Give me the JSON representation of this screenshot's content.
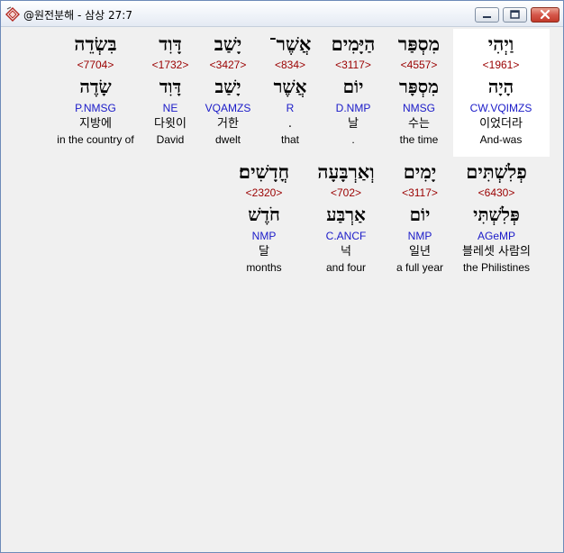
{
  "window": {
    "title": "@원전분해 - 삼상 27:7",
    "icons": {
      "app": "bible-book-icon",
      "minimize": "minimize-icon",
      "maximize": "maximize-icon",
      "close": "close-icon"
    },
    "colors": {
      "strong": "#9a0000",
      "parse": "#1a1ac8",
      "highlight": "#ffffff",
      "background": "#f0f0f0"
    }
  },
  "rows": [
    {
      "words": [
        {
          "hebrew": "וַיְהִי",
          "strong": "<1961>",
          "lemma": "הָיָה",
          "parse": "CW.VQIMZS",
          "korean": "이었더라",
          "english": "And-was",
          "selected": true
        },
        {
          "hebrew": "מִסְפַּר",
          "strong": "<4557>",
          "lemma": "מִסְפָּר",
          "parse": "NMSG",
          "korean": "수는",
          "english": "the time"
        },
        {
          "hebrew": "הַיָּמִים",
          "strong": "<3117>",
          "lemma": "יוֹם",
          "parse": "D.NMP",
          "korean": "날",
          "english": "."
        },
        {
          "hebrew": "אֲשֶׁר־",
          "strong": "<834>",
          "lemma": "אֲשֶׁר",
          "parse": "R",
          "korean": ".",
          "english": "that"
        },
        {
          "hebrew": "יָשַׁב",
          "strong": "<3427>",
          "lemma": "יָשַׁב",
          "parse": "VQAMZS",
          "korean": "거한",
          "english": "dwelt"
        },
        {
          "hebrew": "דָּוִד",
          "strong": "<1732>",
          "lemma": "דָּוִד",
          "parse": "NE",
          "korean": "다윗이",
          "english": "David"
        },
        {
          "hebrew": "בִּשְׂדֵה",
          "strong": "<7704>",
          "lemma": "שָׂדֶה",
          "parse": "P.NMSG",
          "korean": "지방에",
          "english": "in the country of"
        }
      ]
    },
    {
      "words": [
        {
          "hebrew": "פְלִשְׁתִּים",
          "strong": "<6430>",
          "lemma": "פְּלִשְׁתִּי",
          "parse": "AGeMP",
          "korean": "블레셋 사람의",
          "english": "the Philistines"
        },
        {
          "hebrew": "יָמִים",
          "strong": "<3117>",
          "lemma": "יוֹם",
          "parse": "NMP",
          "korean": "일년",
          "english": "a full year"
        },
        {
          "hebrew": "וְאַרְבָּעָה",
          "strong": "<702>",
          "lemma": "אַרְבַּע",
          "parse": "C.ANCF",
          "korean": "넉",
          "english": "and four"
        },
        {
          "hebrew": "חֳדָשִׁים׃",
          "strong": "<2320>",
          "lemma": "חֹדֶשׁ",
          "parse": "NMP",
          "korean": "달",
          "english": "months"
        }
      ]
    }
  ]
}
